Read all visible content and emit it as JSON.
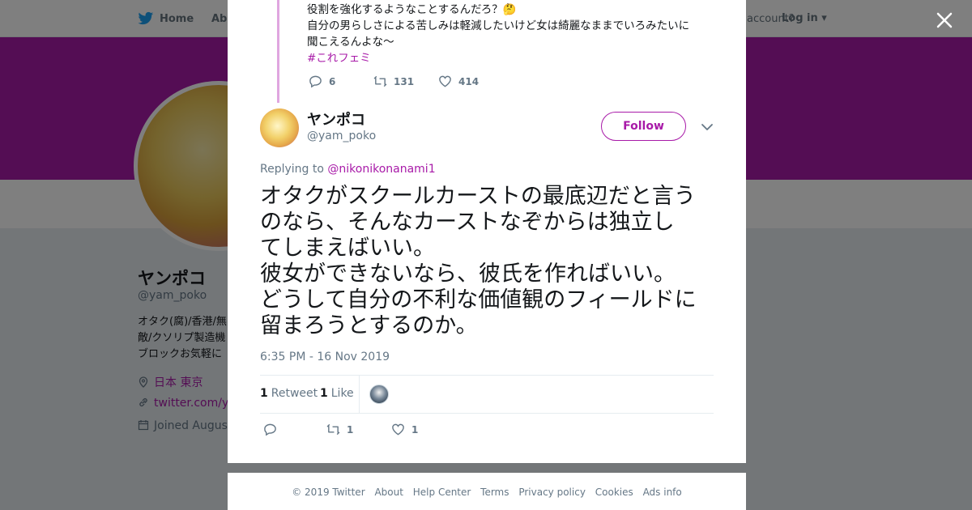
{
  "background": {
    "nav": {
      "home": "Home",
      "about": "Abo",
      "account": "account?",
      "login": "Log in"
    },
    "profile": {
      "name": "ヤンポコ",
      "handle": "@yam_poko",
      "bio_lines": [
        "オタク(腐)/香港/無",
        "敵/クソリプ製造機",
        "ブロックお気軽に"
      ],
      "location": "日本 東京",
      "website": "twitter.com/yam",
      "joined": "Joined August"
    }
  },
  "parent_tweet": {
    "lines": [
      "役割を強化するようなことするんだろ？🤔",
      "自分の男らしさによる苦しみは軽減したいけど女は綺麗なままでいろみたいに",
      "聞こえるんよな〜"
    ],
    "hashtag": "#これフェミ",
    "replies": "6",
    "retweets": "131",
    "likes": "414"
  },
  "tweet": {
    "name": "ヤンポコ",
    "handle": "@yam_poko",
    "follow_label": "Follow",
    "replying_prefix": "Replying to",
    "replying_to": "@nikonikonanami1",
    "text": "オタクがスクールカーストの最底辺だと言う\nのなら、そんなカーストなぞからは独立し\nてしまえばいい。\n彼女ができないなら、彼氏を作ればいい。\nどうして自分の不利な価値観のフィールドに\n留まろうとするのか。",
    "timestamp": "6:35 PM - 16 Nov 2019",
    "retweet_count": "1",
    "retweet_label": "Retweet",
    "like_count": "1",
    "like_label": "Like",
    "action_retweets": "1",
    "action_likes": "1"
  },
  "footer": {
    "links": [
      "© 2019 Twitter",
      "About",
      "Help Center",
      "Terms",
      "Privacy policy",
      "Cookies",
      "Ads info"
    ]
  },
  "colors": {
    "accent": "#a81aa8",
    "text": "#14171a",
    "muted": "#657786"
  },
  "icons": [
    "twitter-bird-icon",
    "close-icon",
    "reply-icon",
    "retweet-icon",
    "heart-icon",
    "chevron-down-icon",
    "location-icon",
    "link-icon",
    "calendar-icon"
  ]
}
